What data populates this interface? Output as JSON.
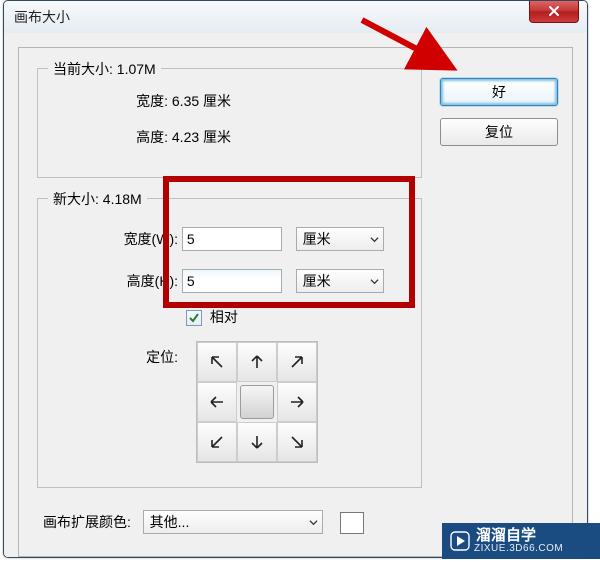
{
  "window": {
    "title": "画布大小"
  },
  "buttons": {
    "ok": "好",
    "reset": "复位"
  },
  "current": {
    "legend": "当前大小: 1.07M",
    "width_label": "宽度:",
    "width_value": "6.35 厘米",
    "height_label": "高度:",
    "height_value": "4.23 厘米"
  },
  "newsize": {
    "legend": "新大小: 4.18M",
    "width_label": "宽度(W):",
    "width_value": "5",
    "width_unit": "厘米",
    "height_label": "高度(H):",
    "height_value": "5",
    "height_unit": "厘米",
    "relative_label": "相对",
    "anchor_label": "定位:"
  },
  "extension": {
    "label": "画布扩展颜色:",
    "value": "其他..."
  },
  "watermark": {
    "brand": "溜溜自学",
    "url": "ZIXUE.3D66.COM"
  }
}
